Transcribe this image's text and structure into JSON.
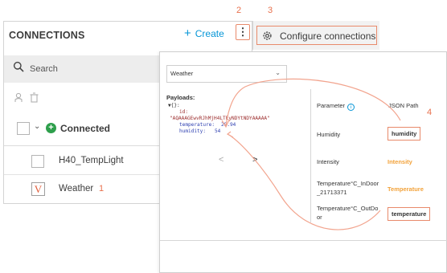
{
  "connections": {
    "title": "CONNECTIONS",
    "create_label": "Create",
    "kebab_glyph": "⋮",
    "search_placeholder": "Search",
    "group": {
      "label": "Connected"
    },
    "items": [
      {
        "label": "H40_TempLight",
        "checked": false
      },
      {
        "label": "Weather",
        "checked": true,
        "mark": "V",
        "step": "1"
      }
    ]
  },
  "steps": {
    "kebab": "2",
    "configure": "3",
    "mapping": "4"
  },
  "configure_menu": {
    "label": "Configure connections",
    "icon": "gear-icon"
  },
  "dialog": {
    "dropdown_value": "Weather",
    "payloads_title": "Payloads:",
    "json_lines": {
      "l1": "▼{}:",
      "l2": "id:",
      "l3": "\"AQAAAGEwvRJhMjH4LTEyNDYtNDYAAAAA\"",
      "l4_key": "temperature:",
      "l4_val": "29.94",
      "l5_key": "humidity:",
      "l5_val": "54"
    },
    "nav": {
      "prev": "<",
      "next": ">"
    },
    "mapping": {
      "header_param": "Parameter",
      "header_json": "JSON Path",
      "rows": [
        {
          "param": "Humidity",
          "path": "humidity",
          "style": "boxed"
        },
        {
          "param": "Intensity",
          "path": "Intensity",
          "style": "orange"
        },
        {
          "param_line1": "Temperature°C_InDoor",
          "param_line2": "_21713371",
          "path": "Temperature",
          "style": "orange"
        },
        {
          "param_line1": "Temperature°C_OutDo",
          "param_line2": "or",
          "path": "temperature",
          "style": "boxed"
        }
      ]
    }
  },
  "colors": {
    "accent": "#0696d7",
    "annotation": "#e8704d",
    "connected_green": "#2e9f4c",
    "mapped_orange": "#f2a23a"
  }
}
